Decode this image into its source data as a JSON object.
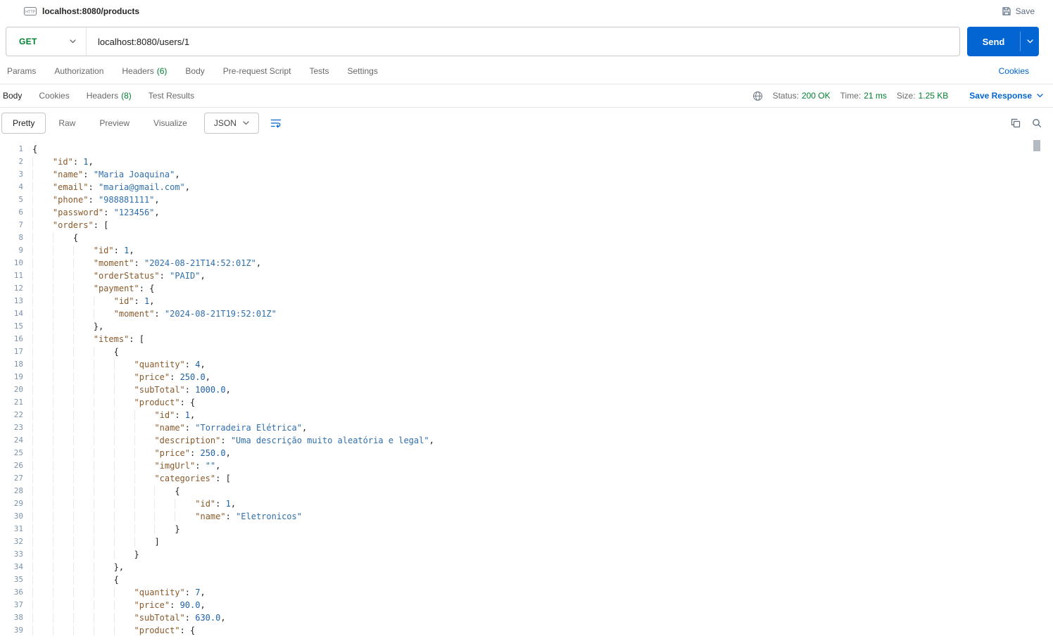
{
  "topbar": {
    "tab_title": "localhost:8080/products",
    "save_label": "Save"
  },
  "request": {
    "method": "GET",
    "url": "localhost:8080/users/1",
    "send_label": "Send"
  },
  "request_tabs": [
    {
      "label": "Params"
    },
    {
      "label": "Authorization"
    },
    {
      "label": "Headers",
      "count": "(6)"
    },
    {
      "label": "Body"
    },
    {
      "label": "Pre-request Script"
    },
    {
      "label": "Tests"
    },
    {
      "label": "Settings"
    }
  ],
  "cookies_link": "Cookies",
  "response": {
    "tabs": [
      {
        "label": "Body",
        "active": true
      },
      {
        "label": "Cookies"
      },
      {
        "label": "Headers",
        "count": "(8)"
      },
      {
        "label": "Test Results"
      }
    ],
    "status": {
      "label": "Status:",
      "value": "200 OK"
    },
    "time": {
      "label": "Time:",
      "value": "21 ms"
    },
    "size": {
      "label": "Size:",
      "value": "1.25 KB"
    },
    "save_response_label": "Save Response"
  },
  "viewer": {
    "modes": [
      "Pretty",
      "Raw",
      "Preview",
      "Visualize"
    ],
    "active_mode": "Pretty",
    "format": "JSON"
  },
  "colors": {
    "accent_blue": "#0265d2",
    "method_green": "#007f31",
    "status_green": "#007f31",
    "tk_key": "#8a5a2b",
    "tk_str": "#2f6fad",
    "tk_num": "#1e61a5",
    "ln_color": "#7d93aa"
  },
  "code_lines": [
    "{",
    "    \"id\": 1,",
    "    \"name\": \"Maria Joaquina\",",
    "    \"email\": \"maria@gmail.com\",",
    "    \"phone\": \"988881111\",",
    "    \"password\": \"123456\",",
    "    \"orders\": [",
    "        {",
    "            \"id\": 1,",
    "            \"moment\": \"2024-08-21T14:52:01Z\",",
    "            \"orderStatus\": \"PAID\",",
    "            \"payment\": {",
    "                \"id\": 1,",
    "                \"moment\": \"2024-08-21T19:52:01Z\"",
    "            },",
    "            \"items\": [",
    "                {",
    "                    \"quantity\": 4,",
    "                    \"price\": 250.0,",
    "                    \"subTotal\": 1000.0,",
    "                    \"product\": {",
    "                        \"id\": 1,",
    "                        \"name\": \"Torradeira Elétrica\",",
    "                        \"description\": \"Uma descrição muito aleatória e legal\",",
    "                        \"price\": 250.0,",
    "                        \"imgUrl\": \"\",",
    "                        \"categories\": [",
    "                            {",
    "                                \"id\": 1,",
    "                                \"name\": \"Eletronicos\"",
    "                            }",
    "                        ]",
    "                    }",
    "                },",
    "                {",
    "                    \"quantity\": 7,",
    "                    \"price\": 90.0,",
    "                    \"subTotal\": 630.0,",
    "                    \"product\": {"
  ]
}
